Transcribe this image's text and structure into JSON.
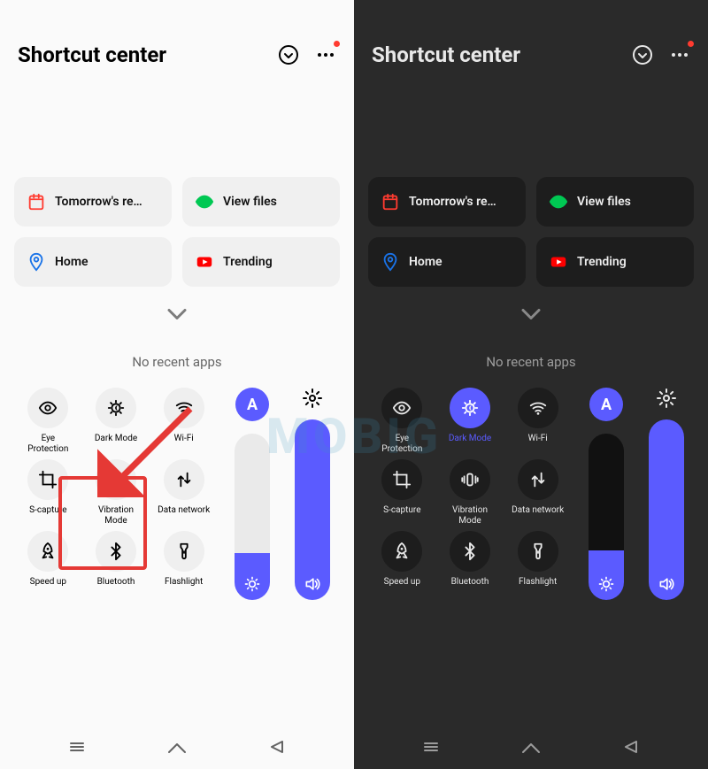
{
  "header": {
    "title": "Shortcut center"
  },
  "cards": [
    {
      "icon": "calendar",
      "label": "Tomorrow's re…",
      "iconColor": "#ff3b30"
    },
    {
      "icon": "eye",
      "label": "View files",
      "iconColor": "#00c853"
    },
    {
      "icon": "maps",
      "label": "Home",
      "iconColor": "#1a73e8"
    },
    {
      "icon": "youtube",
      "label": "Trending",
      "iconColor": "#ff0000"
    }
  ],
  "recent": {
    "noRecent": "No recent apps"
  },
  "tiles": [
    {
      "id": "eye-protection",
      "label": "Eye Protection",
      "icon": "eye"
    },
    {
      "id": "dark-mode",
      "label": "Dark Mode",
      "icon": "moon-sun"
    },
    {
      "id": "wifi",
      "label": "Wi-Fi",
      "icon": "wifi"
    },
    {
      "id": "s-capture",
      "label": "S-capture",
      "icon": "crop"
    },
    {
      "id": "vibration",
      "label": "Vibration Mode",
      "icon": "vibration"
    },
    {
      "id": "data-network",
      "label": "Data network",
      "icon": "data"
    },
    {
      "id": "speedup",
      "label": "Speed up",
      "icon": "rocket"
    },
    {
      "id": "bluetooth",
      "label": "Bluetooth",
      "icon": "bluetooth"
    },
    {
      "id": "flashlight",
      "label": "Flashlight",
      "icon": "flashlight"
    }
  ],
  "sliders": {
    "auto_label": "A",
    "brightness_percent_light": 28,
    "brightness_percent_dark": 30,
    "volume_percent": 100
  },
  "watermark": "MOBIG",
  "colors": {
    "accent": "#5b5bff",
    "highlight": "#e53935"
  },
  "darkModeActiveInDarkScreen": true
}
